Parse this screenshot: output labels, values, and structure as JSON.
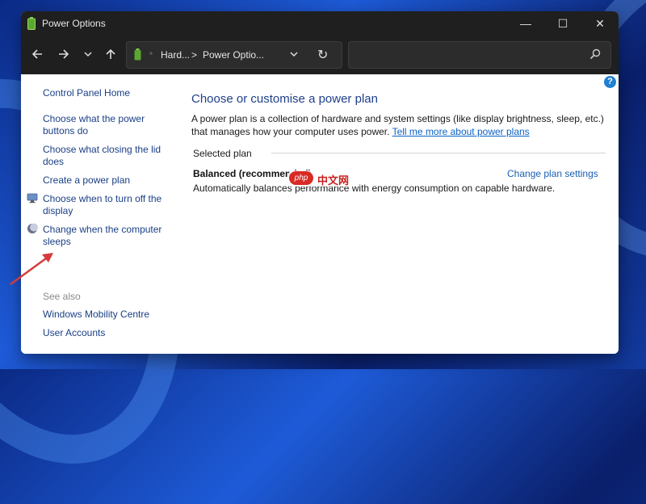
{
  "window": {
    "title": "Power Options",
    "controls": {
      "minimize": "—",
      "maximize": "☐",
      "close": "✕"
    }
  },
  "navbar": {
    "back_icon": "arrow-left-icon",
    "forward_icon": "arrow-right-icon",
    "recent_icon": "chevron-down-icon",
    "up_icon": "arrow-up-icon",
    "address": {
      "small": "»",
      "crumb1": "Hard...",
      "separator": ">",
      "crumb2": "Power Optio...",
      "chevron": "⌄",
      "refresh": "↻"
    },
    "search": {
      "placeholder": "",
      "icon": "search-icon"
    }
  },
  "help": "?",
  "sidebar": {
    "home": "Control Panel Home",
    "items": [
      {
        "label": "Choose what the power buttons do"
      },
      {
        "label": "Choose what closing the lid does"
      },
      {
        "label": "Create a power plan"
      },
      {
        "label": "Choose when to turn off the display",
        "icon": "monitor-icon"
      },
      {
        "label": "Change when the computer sleeps",
        "icon": "moon-icon"
      }
    ],
    "see_also": "See also",
    "see_also_links": [
      "Windows Mobility Centre",
      "User Accounts"
    ]
  },
  "main": {
    "title": "Choose or customise a power plan",
    "description": "A power plan is a collection of hardware and system settings (like display brightness, sleep, etc.) that manages how your computer uses power.",
    "learn_more": "Tell me more about power plans",
    "selected_plan_label": "Selected plan",
    "plan": {
      "name": "Balanced (recommended)",
      "settings_link": "Change plan settings",
      "description": "Automatically balances performance with energy consumption on capable hardware."
    }
  },
  "watermark": {
    "badge": "php",
    "text": "中文网"
  },
  "colors": {
    "titlebar": "#1f1f1f",
    "link": "#1a3f86",
    "heading": "#1e3f8a",
    "annotation_arrow": "#d63a3a"
  }
}
